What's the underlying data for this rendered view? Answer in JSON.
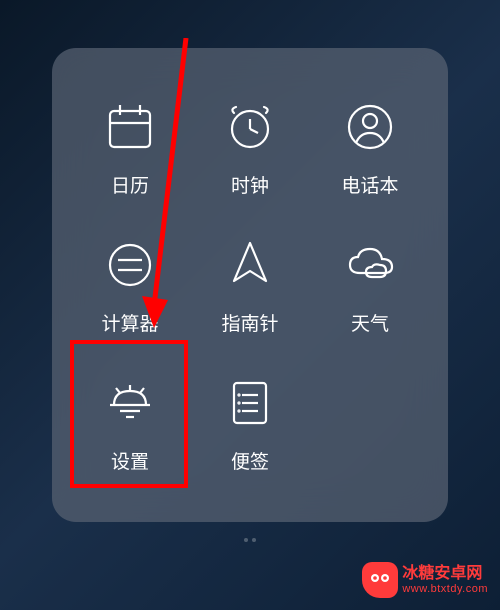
{
  "apps": {
    "calendar": {
      "label": "日历",
      "icon": "calendar-icon"
    },
    "clock": {
      "label": "时钟",
      "icon": "clock-icon"
    },
    "contacts": {
      "label": "电话本",
      "icon": "contacts-icon"
    },
    "calculator": {
      "label": "计算器",
      "icon": "calculator-icon"
    },
    "compass": {
      "label": "指南针",
      "icon": "compass-icon"
    },
    "weather": {
      "label": "天气",
      "icon": "weather-icon"
    },
    "settings": {
      "label": "设置",
      "icon": "settings-icon"
    },
    "notes": {
      "label": "便签",
      "icon": "notes-icon"
    }
  },
  "annotation": {
    "highlight_target": "settings",
    "arrow_color": "#ff0000",
    "highlight_color": "#ff0000"
  },
  "watermark": {
    "brand": "冰糖安卓网",
    "url": "www.btxtdy.com"
  }
}
